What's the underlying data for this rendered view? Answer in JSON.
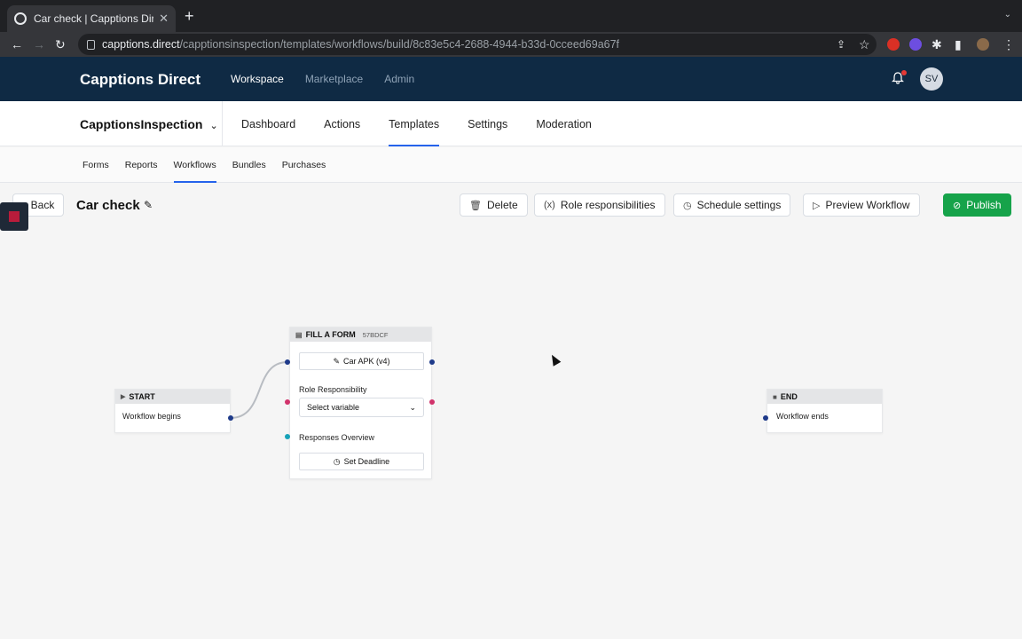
{
  "browser": {
    "tab_title": "Car check | Capptions Direct",
    "new_tab": "+",
    "url_host": "capptions.direct",
    "url_path": "/capptionsinspection/templates/workflows/build/8c83e5c4-2688-4944-b33d-0cceed69a67f"
  },
  "app": {
    "brand": "Capptions Direct",
    "nav": [
      "Workspace",
      "Marketplace",
      "Admin"
    ],
    "avatar_initials": "SV"
  },
  "workspace": {
    "name": "CapptionsInspection"
  },
  "secondary_nav": [
    "Dashboard",
    "Actions",
    "Templates",
    "Settings",
    "Moderation"
  ],
  "tertiary_nav": [
    "Forms",
    "Reports",
    "Workflows",
    "Bundles",
    "Purchases"
  ],
  "toolbar": {
    "back": "Back",
    "title": "Car check",
    "delete": "Delete",
    "role": "Role responsibilities",
    "schedule": "Schedule settings",
    "preview": "Preview Workflow",
    "publish": "Publish"
  },
  "nodes": {
    "start": {
      "header": "START",
      "label": "Workflow begins"
    },
    "form": {
      "header": "FILL A FORM",
      "code": "57BDCF",
      "form_button": "Car APK (v4)",
      "role_label": "Role Responsibility",
      "select_placeholder": "Select variable",
      "responses_label": "Responses Overview",
      "deadline_button": "Set Deadline"
    },
    "end": {
      "header": "END",
      "label": "Workflow ends"
    }
  },
  "colors": {
    "header_bg": "#0f2a44",
    "publish": "#16a34a",
    "port_blue": "#1e3a8a",
    "port_pink": "#d1336b",
    "port_teal": "#17a2b8",
    "active_underline": "#2563eb"
  }
}
